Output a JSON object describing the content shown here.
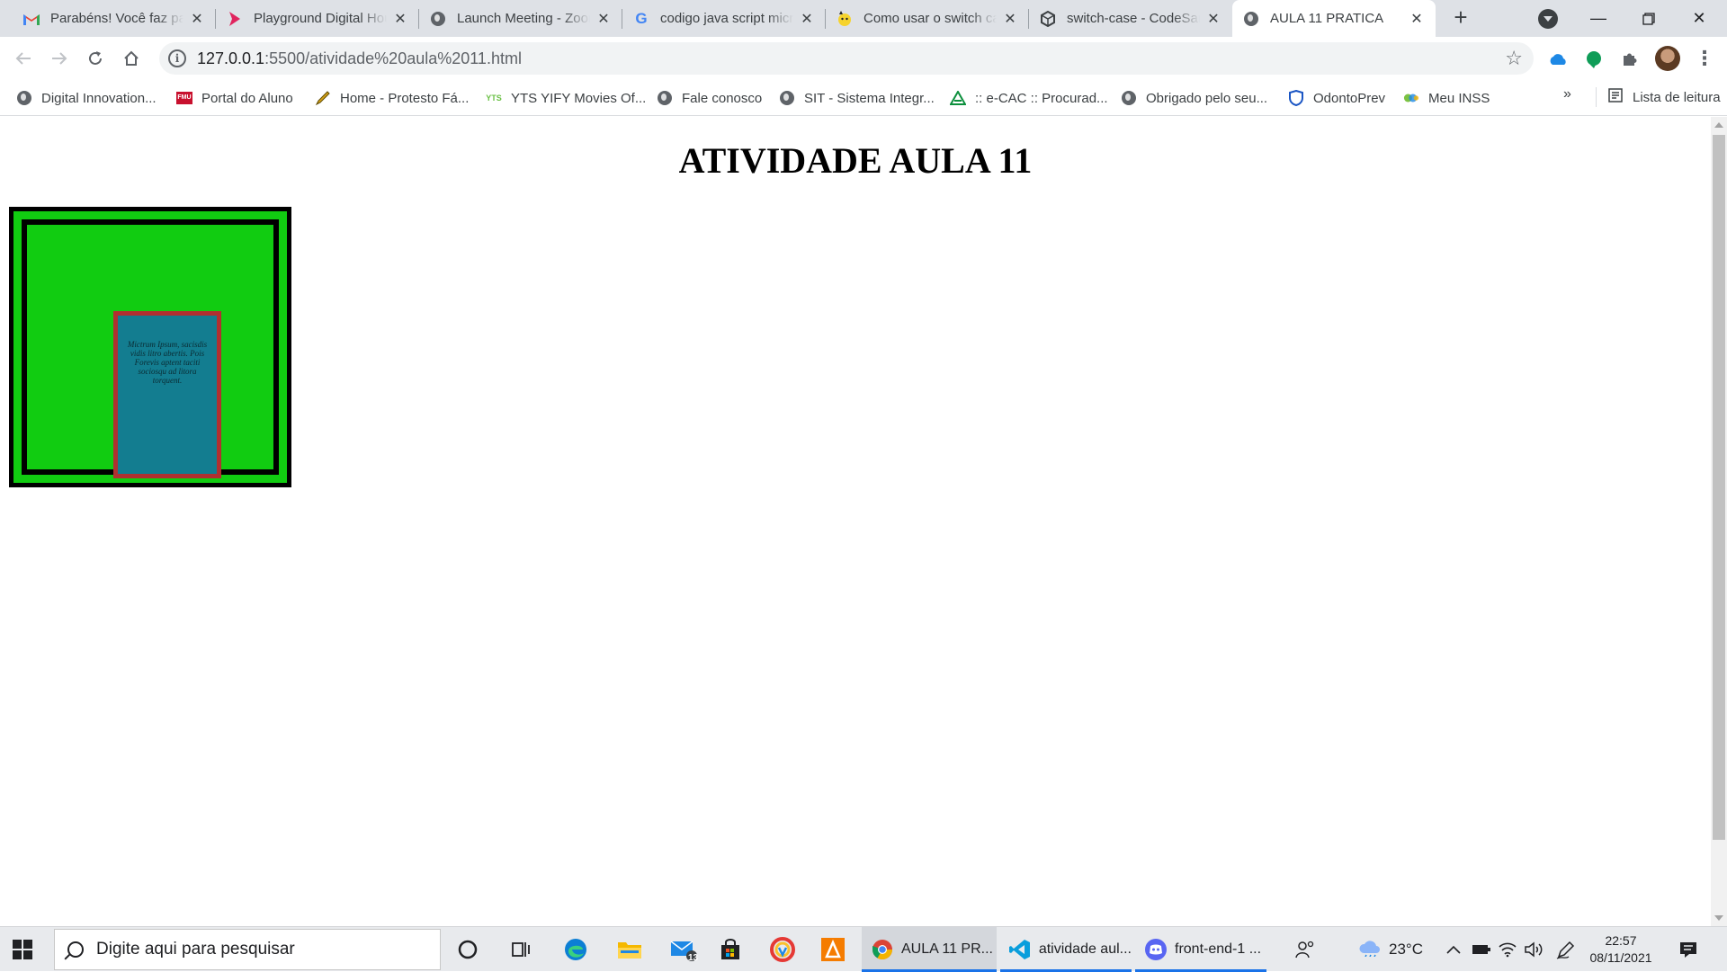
{
  "tabs": [
    {
      "title": "Parabéns! Você faz parte",
      "icon": "gmail-icon"
    },
    {
      "title": "Playground Digital House",
      "icon": "playground-icon"
    },
    {
      "title": "Launch Meeting - Zoom",
      "icon": "globe-icon"
    },
    {
      "title": "codigo java script micro",
      "icon": "google-icon"
    },
    {
      "title": "Como usar o switch case",
      "icon": "pikachu-icon"
    },
    {
      "title": "switch-case - CodeSandbox",
      "icon": "codesandbox-icon"
    },
    {
      "title": "AULA 11 PRATICA",
      "icon": "globe-icon"
    }
  ],
  "address": {
    "host": "127.0.0.1",
    "path": ":5500/atividade%20aula%2011.html"
  },
  "bookmarks": [
    {
      "label": "Digital Innovation...",
      "icon": "globe-icon"
    },
    {
      "label": "Portal do Aluno",
      "icon": "fmu-icon"
    },
    {
      "label": "Home - Protesto Fá...",
      "icon": "pen-icon"
    },
    {
      "label": "YTS YIFY Movies Of...",
      "icon": "yts-icon"
    },
    {
      "label": "Fale conosco",
      "icon": "globe-icon"
    },
    {
      "label": "SIT - Sistema Integr...",
      "icon": "globe-icon"
    },
    {
      "label": ":: e-CAC :: Procurad...",
      "icon": "ecac-icon"
    },
    {
      "label": "Obrigado pelo seu...",
      "icon": "globe-icon"
    },
    {
      "label": "OdontoPrev",
      "icon": "shield-icon"
    },
    {
      "label": "Meu INSS",
      "icon": "inss-icon"
    }
  ],
  "reading_list_label": "Lista de leitura",
  "page": {
    "heading": "ATIVIDADE AULA 11",
    "box_text": "Mictrum Ipsum, sacisdis vidis litro abertis. Pois Forevis aptent taciti sociosqu ad litora torquent."
  },
  "taskbar": {
    "search_placeholder": "Digite aqui para pesquisar",
    "mail_badge": "13",
    "apps": [
      {
        "label": "AULA 11 PR...",
        "icon": "chrome-icon"
      },
      {
        "label": "atividade aul...",
        "icon": "vscode-icon"
      },
      {
        "label": "front-end-1 ...",
        "icon": "discord-icon"
      }
    ],
    "temperature": "23°C",
    "time": "22:57",
    "date": "08/11/2021"
  },
  "colors": {
    "outer_green": "#11cc11",
    "inner_teal": "#137d90",
    "inner_border_red": "#b03030",
    "frame_black": "#000000"
  }
}
